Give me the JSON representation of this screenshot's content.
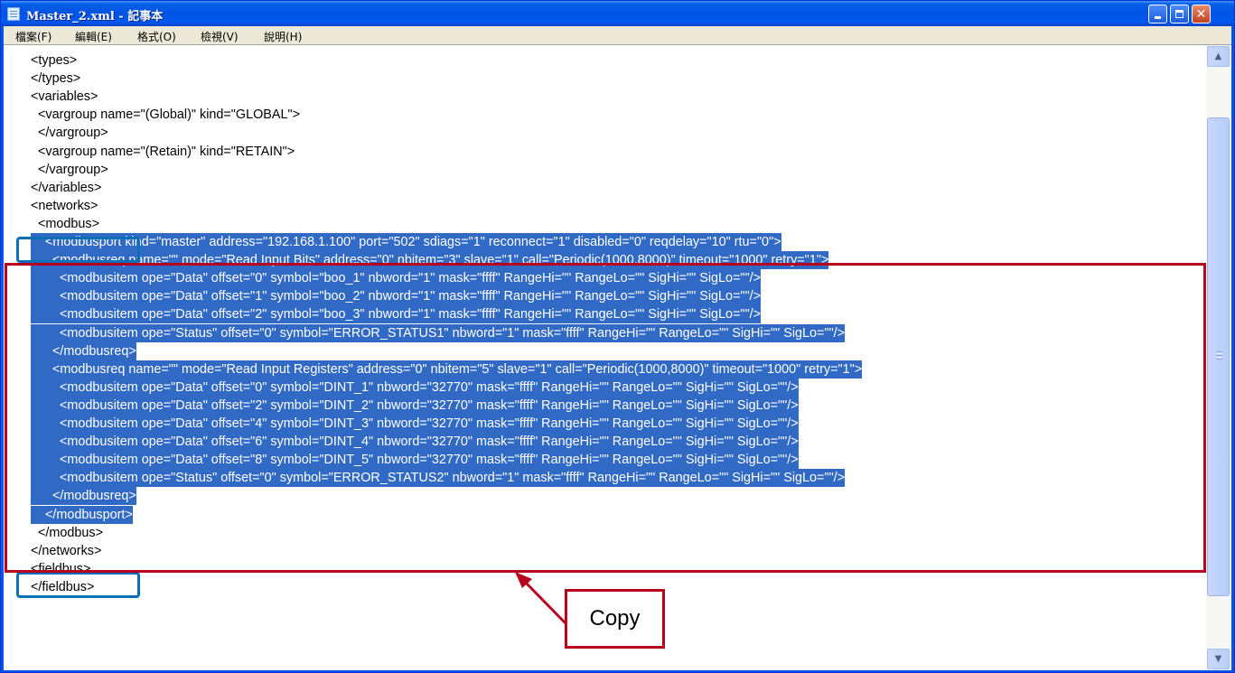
{
  "window": {
    "title": "Master_2.xml - 記事本",
    "minimize_label": "minimize",
    "maximize_label": "maximize",
    "close_label": "close"
  },
  "menu": [
    {
      "label": "檔案(F)"
    },
    {
      "label": "編輯(E)"
    },
    {
      "label": "格式(O)"
    },
    {
      "label": "檢視(V)"
    },
    {
      "label": "說明(H)"
    }
  ],
  "editor": {
    "lines": [
      {
        "text": "<types>",
        "selected": false
      },
      {
        "text": "</types>",
        "selected": false
      },
      {
        "text": "<variables>",
        "selected": false
      },
      {
        "text": "  <vargroup name=\"(Global)\" kind=\"GLOBAL\">",
        "selected": false
      },
      {
        "text": "  </vargroup>",
        "selected": false
      },
      {
        "text": "  <vargroup name=\"(Retain)\" kind=\"RETAIN\">",
        "selected": false
      },
      {
        "text": "  </vargroup>",
        "selected": false
      },
      {
        "text": "</variables>",
        "selected": false
      },
      {
        "text": "<networks>",
        "selected": false
      },
      {
        "text": "  <modbus>",
        "selected": false
      },
      {
        "text": "    <modbusport kind=\"master\" address=\"192.168.1.100\" port=\"502\" sdiags=\"1\" reconnect=\"1\" disabled=\"0\" reqdelay=\"10\" rtu=\"0\">",
        "selected": true
      },
      {
        "text": "      <modbusreq name=\"\" mode=\"Read Input Bits\" address=\"0\" nbitem=\"3\" slave=\"1\" call=\"Periodic(1000,8000)\" timeout=\"1000\" retry=\"1\">",
        "selected": true
      },
      {
        "text": "        <modbusitem ope=\"Data\" offset=\"0\" symbol=\"boo_1\" nbword=\"1\" mask=\"ffff\" RangeHi=\"\" RangeLo=\"\" SigHi=\"\" SigLo=\"\"/>",
        "selected": true
      },
      {
        "text": "        <modbusitem ope=\"Data\" offset=\"1\" symbol=\"boo_2\" nbword=\"1\" mask=\"ffff\" RangeHi=\"\" RangeLo=\"\" SigHi=\"\" SigLo=\"\"/>",
        "selected": true
      },
      {
        "text": "        <modbusitem ope=\"Data\" offset=\"2\" symbol=\"boo_3\" nbword=\"1\" mask=\"ffff\" RangeHi=\"\" RangeLo=\"\" SigHi=\"\" SigLo=\"\"/>",
        "selected": true
      },
      {
        "text": "        <modbusitem ope=\"Status\" offset=\"0\" symbol=\"ERROR_STATUS1\" nbword=\"1\" mask=\"ffff\" RangeHi=\"\" RangeLo=\"\" SigHi=\"\" SigLo=\"\"/>",
        "selected": true
      },
      {
        "text": "      </modbusreq>",
        "selected": true
      },
      {
        "text": "      <modbusreq name=\"\" mode=\"Read Input Registers\" address=\"0\" nbitem=\"5\" slave=\"1\" call=\"Periodic(1000,8000)\" timeout=\"1000\" retry=\"1\">",
        "selected": true
      },
      {
        "text": "        <modbusitem ope=\"Data\" offset=\"0\" symbol=\"DINT_1\" nbword=\"32770\" mask=\"ffff\" RangeHi=\"\" RangeLo=\"\" SigHi=\"\" SigLo=\"\"/>",
        "selected": true
      },
      {
        "text": "        <modbusitem ope=\"Data\" offset=\"2\" symbol=\"DINT_2\" nbword=\"32770\" mask=\"ffff\" RangeHi=\"\" RangeLo=\"\" SigHi=\"\" SigLo=\"\"/>",
        "selected": true
      },
      {
        "text": "        <modbusitem ope=\"Data\" offset=\"4\" symbol=\"DINT_3\" nbword=\"32770\" mask=\"ffff\" RangeHi=\"\" RangeLo=\"\" SigHi=\"\" SigLo=\"\"/>",
        "selected": true
      },
      {
        "text": "        <modbusitem ope=\"Data\" offset=\"6\" symbol=\"DINT_4\" nbword=\"32770\" mask=\"ffff\" RangeHi=\"\" RangeLo=\"\" SigHi=\"\" SigLo=\"\"/>",
        "selected": true
      },
      {
        "text": "        <modbusitem ope=\"Data\" offset=\"8\" symbol=\"DINT_5\" nbword=\"32770\" mask=\"ffff\" RangeHi=\"\" RangeLo=\"\" SigHi=\"\" SigLo=\"\"/>",
        "selected": true
      },
      {
        "text": "        <modbusitem ope=\"Status\" offset=\"0\" symbol=\"ERROR_STATUS2\" nbword=\"1\" mask=\"ffff\" RangeHi=\"\" RangeLo=\"\" SigHi=\"\" SigLo=\"\"/>",
        "selected": true
      },
      {
        "text": "      </modbusreq>",
        "selected": true
      },
      {
        "text": "    </modbusport>",
        "selected": true
      },
      {
        "text": "  </modbus>",
        "selected": false
      },
      {
        "text": "</networks>",
        "selected": false
      },
      {
        "text": "<fieldbus>",
        "selected": false
      },
      {
        "text": "</fieldbus>",
        "selected": false
      }
    ]
  },
  "annotation": {
    "callout_text": "Copy",
    "blue_color": "#0b6fb8",
    "red_color": "#b8001e"
  },
  "colors": {
    "selection": "#316ac5",
    "titlebar": "#0054e3"
  }
}
